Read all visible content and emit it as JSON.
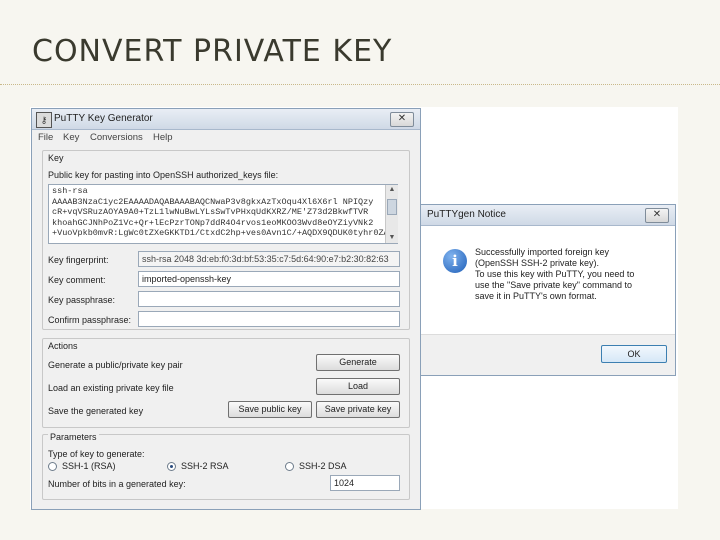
{
  "slide": {
    "title": "CONVERT PRIVATE KEY"
  },
  "keygen": {
    "title": "PuTTY Key Generator",
    "close": "✕",
    "menu": [
      "File",
      "Key",
      "Conversions",
      "Help"
    ],
    "key_group": "Key",
    "pubkey_label": "Public key for pasting into OpenSSH authorized_keys file:",
    "pubkey_lines": [
      "ssh-rsa",
      "AAAAB3NzaC1yc2EAAAADAQABAAABAQCNwaP3v8gkxAzTxOqu4Xl6X6rl NPIQzy",
      "cR+vqVSRuzAOYA9A0+TzL1lwNuBwLYLsSwTvPHxqUdKXRZ/ME'Z73d2BkwfTVR",
      "khoahGCJNhPoZ1Vc+Qr+lEcPzrTONp7ddR4O4rvos1eoMKOO3Wvd8eOYZiyVNk2",
      "+VuoVpkb0mvR:LgWc0tZXeGKKTD1/CtxdC2hp+ves0Avn1C/+AQDX9QDUK0tyhr0ZA"
    ],
    "fingerprint_label": "Key fingerprint:",
    "fingerprint_value": "ssh-rsa 2048 3d:eb:f0:3d:bf:53:35:c7:5d:64:90:e7:b2:30:82:63",
    "comment_label": "Key comment:",
    "comment_value": "imported-openssh-key",
    "passphrase_label": "Key passphrase:",
    "confirm_label": "Confirm passphrase:",
    "actions_group": "Actions",
    "generate_label": "Generate a public/private key pair",
    "generate_btn": "Generate",
    "load_label": "Load an existing private key file",
    "load_btn": "Load",
    "save_label": "Save the generated key",
    "save_public_btn": "Save public key",
    "save_private_btn": "Save private key",
    "params_group": "Parameters",
    "type_label": "Type of key to generate:",
    "radio_options": [
      "SSH-1 (RSA)",
      "SSH-2 RSA",
      "SSH-2 DSA"
    ],
    "selected_type": "SSH-2 RSA",
    "bits_label": "Number of bits in a generated key:",
    "bits_value": "1024"
  },
  "notice": {
    "title": "PuTTYgen Notice",
    "close": "✕",
    "icon": "info-icon",
    "lines": [
      "Successfully imported foreign key",
      "(OpenSSH SSH-2 private key).",
      "To use this key with PuTTY, you need to",
      "use the \"Save private key\" command to",
      "save it in PuTTY's own format."
    ],
    "ok": "OK"
  }
}
